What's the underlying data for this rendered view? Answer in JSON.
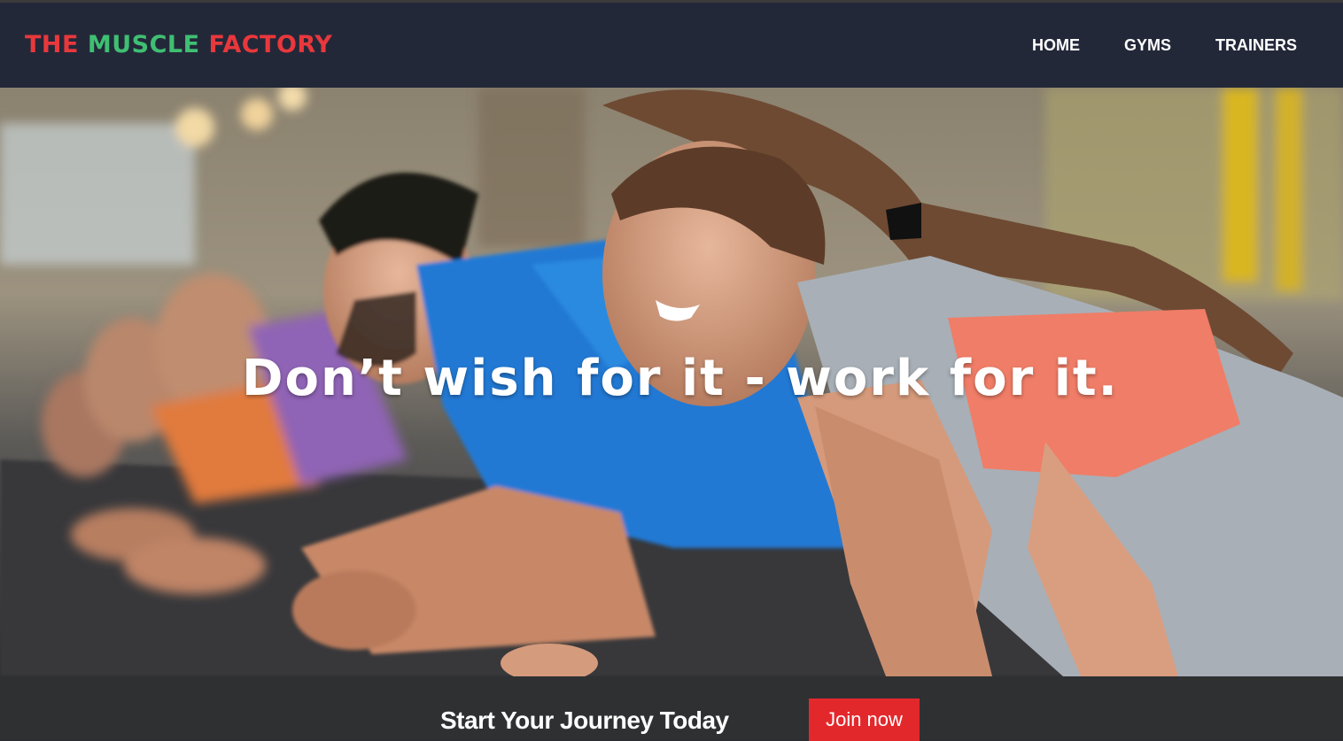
{
  "header": {
    "logo": {
      "word1": "THE MUSCLE",
      "word2": "FACTORY",
      "colors": {
        "the": "#e8383c",
        "muscle": "#3fbf72",
        "factory": "#e8383c"
      }
    },
    "nav": {
      "items": [
        {
          "label": "HOME"
        },
        {
          "label": "GYMS"
        },
        {
          "label": "TRAINERS"
        }
      ]
    }
  },
  "hero": {
    "tagline": "Don’t wish for it - work for it.",
    "image_description_icon": "people-planking-photo"
  },
  "cta": {
    "text": "Start Your Journey Today",
    "button_label": "Join now",
    "button_color": "#e3282c"
  }
}
